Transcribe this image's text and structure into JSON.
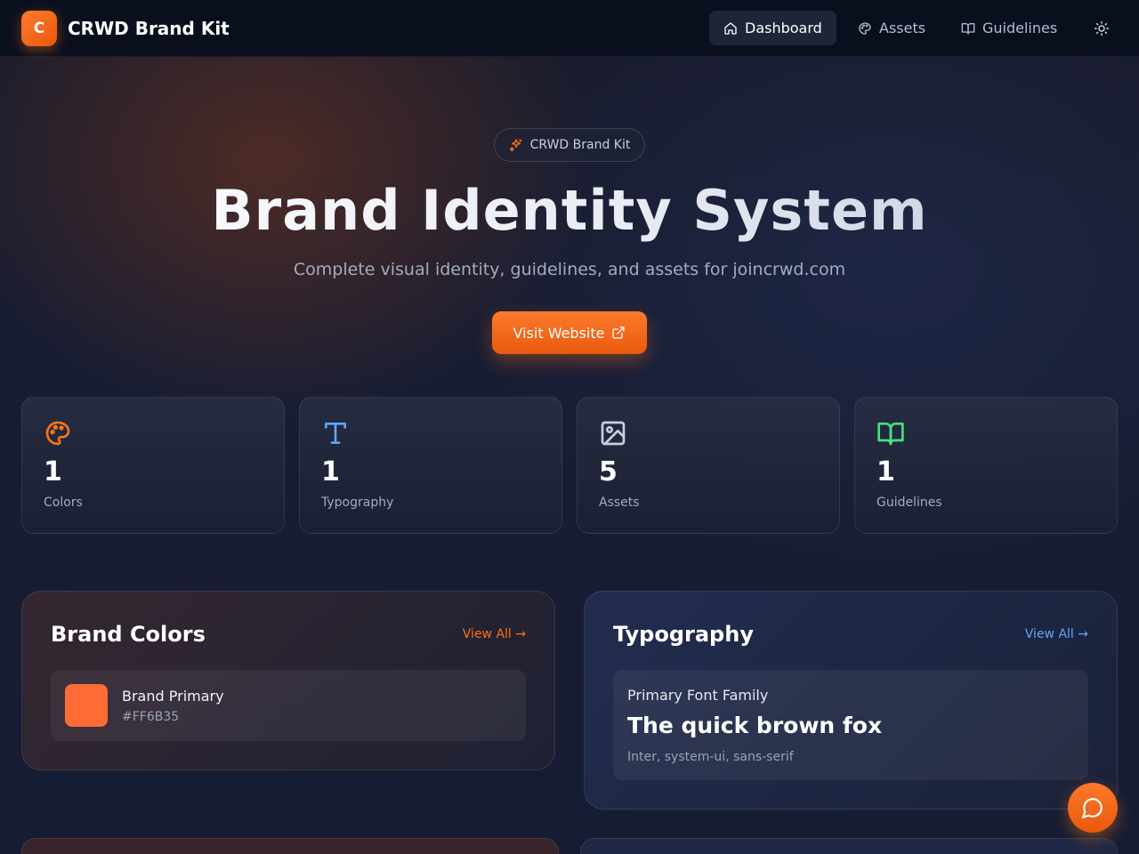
{
  "header": {
    "logo_letter": "C",
    "app_name": "CRWD Brand Kit",
    "nav": [
      {
        "label": "Dashboard",
        "icon": "home-icon",
        "active": true
      },
      {
        "label": "Assets",
        "icon": "palette-icon",
        "active": false
      },
      {
        "label": "Guidelines",
        "icon": "book-icon",
        "active": false
      }
    ],
    "theme_toggle_icon": "sun-icon"
  },
  "hero": {
    "badge": "CRWD Brand Kit",
    "title": "Brand Identity System",
    "subtitle": "Complete visual identity, guidelines, and assets for joincrwd.com",
    "cta_label": "Visit Website"
  },
  "stats": [
    {
      "value": "1",
      "label": "Colors",
      "icon": "palette-icon",
      "color": "#F97316"
    },
    {
      "value": "1",
      "label": "Typography",
      "icon": "type-icon",
      "color": "#60A5FA"
    },
    {
      "value": "5",
      "label": "Assets",
      "icon": "image-icon",
      "color": "#C8CFDD"
    },
    {
      "value": "1",
      "label": "Guidelines",
      "icon": "book-open-icon",
      "color": "#4ADE80"
    }
  ],
  "brand_colors": {
    "title": "Brand Colors",
    "view_all": "View All →",
    "items": [
      {
        "name": "Brand Primary",
        "hex": "#FF6B35"
      }
    ]
  },
  "typography": {
    "title": "Typography",
    "view_all": "View All →",
    "items": [
      {
        "family_label": "Primary Font Family",
        "sample": "The quick brown fox",
        "stack": "Inter, system-ui, sans-serif"
      }
    ]
  },
  "colors": {
    "accent": "#F97316",
    "link_blue": "#60A5FA",
    "guideline_green": "#4ADE80"
  }
}
